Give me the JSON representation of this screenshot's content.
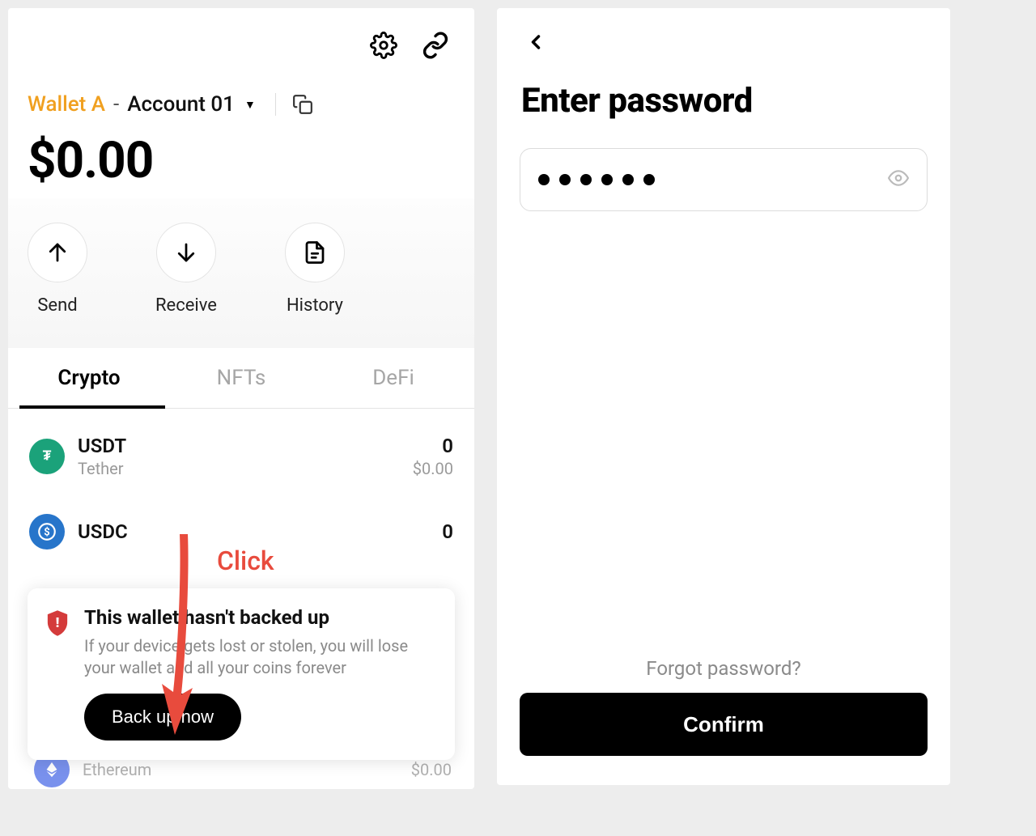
{
  "colors": {
    "accent_orange": "#f0a020",
    "annotation_red": "#e84b3d",
    "usdt_green": "#1ba27a",
    "usdc_blue": "#2775ca",
    "eth_purple": "#627eea"
  },
  "left": {
    "wallet_name": "Wallet A",
    "account_name": "Account 01",
    "balance": "$0.00",
    "actions": {
      "send": "Send",
      "receive": "Receive",
      "history": "History"
    },
    "tabs": {
      "crypto": "Crypto",
      "nfts": "NFTs",
      "defi": "DeFi",
      "active": "crypto"
    },
    "coins": [
      {
        "symbol": "USDT",
        "name": "Tether",
        "amount": "0",
        "usd": "$0.00"
      },
      {
        "symbol": "USDC",
        "name": "",
        "amount": "0",
        "usd": ""
      }
    ],
    "faded_coin": {
      "name": "Ethereum",
      "usd": "$0.00"
    },
    "backup": {
      "title": "This wallet hasn't backed up",
      "desc": "If your device gets lost or stolen, you will lose your wallet and all your coins forever",
      "button": "Back up now"
    },
    "annotation_label": "Click"
  },
  "right": {
    "title": "Enter password",
    "password_dot_count": 6,
    "forgot": "Forgot password?",
    "confirm": "Confirm"
  }
}
